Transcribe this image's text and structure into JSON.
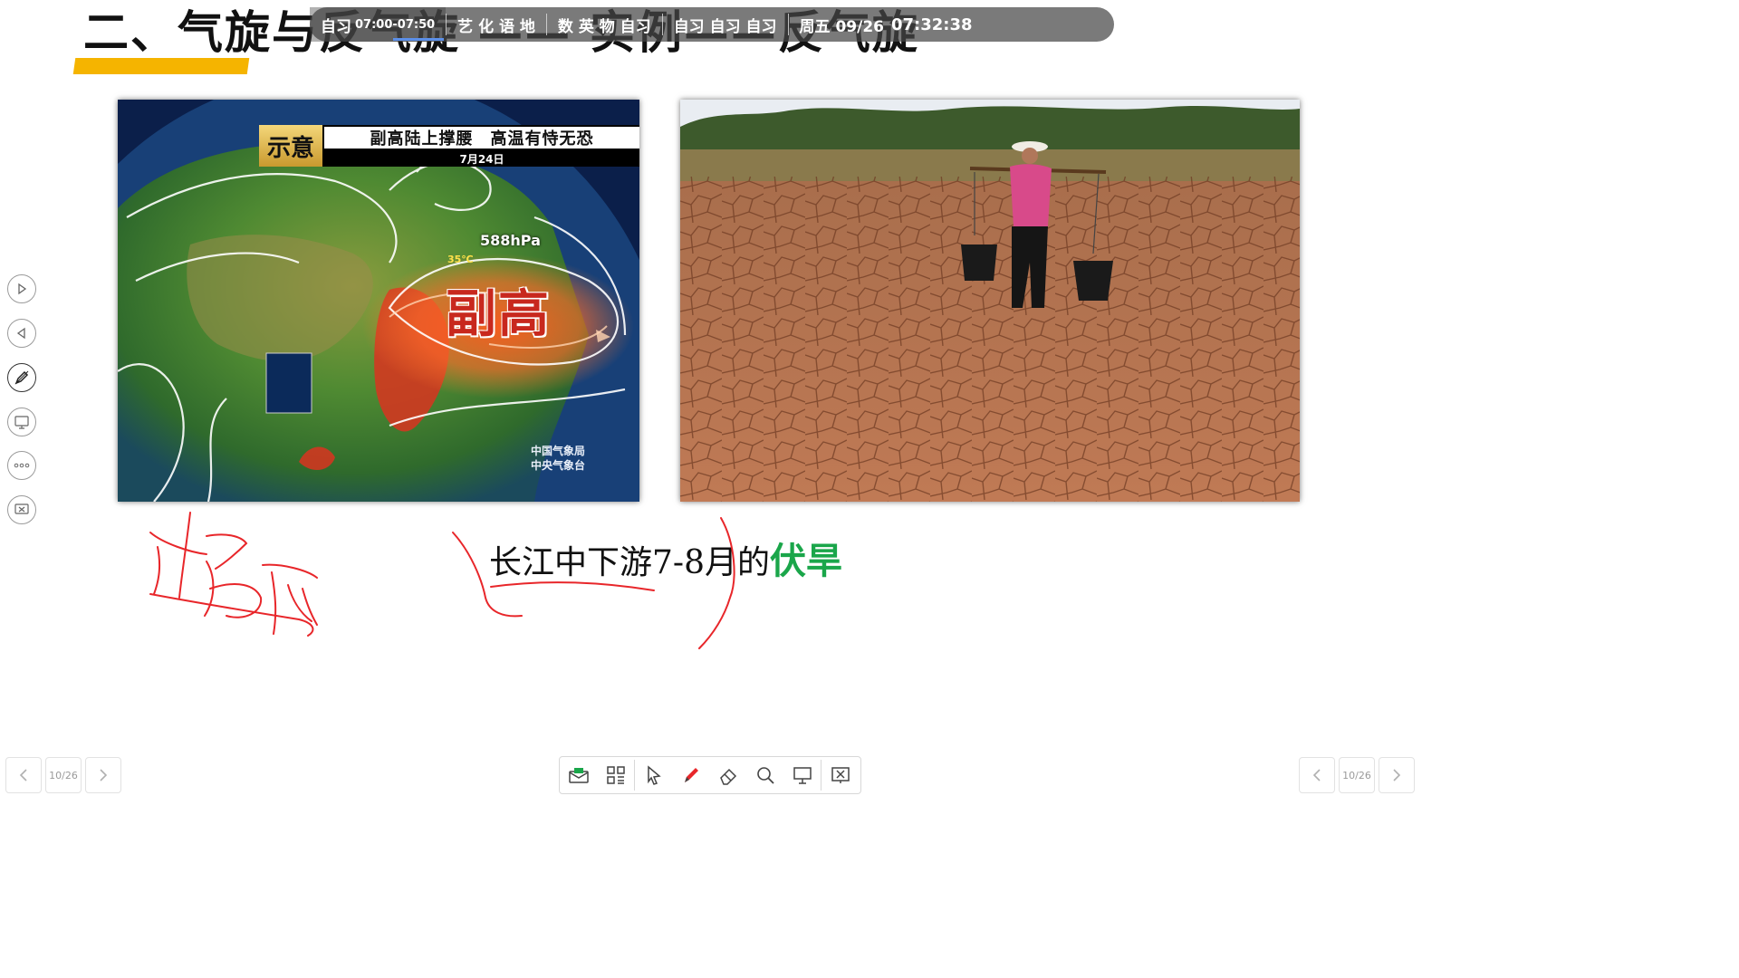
{
  "slide": {
    "title": "二、气旋与反气旋 —— 实例——反气旋",
    "caption_prefix": "长江中下游7-8月的",
    "caption_highlight": "伏旱"
  },
  "schedule_bar": {
    "current_label": "自习",
    "current_time": "07:00-07:50",
    "group1": "艺 化 语 地",
    "group2": "数 英 物 自习",
    "group3": "自习 自习 自习",
    "date": "周五 09/26",
    "clock": "07:32:38"
  },
  "weather_map": {
    "badge": "示意",
    "headline": "副高陆上撑腰　高温有恃无恐",
    "date": "7月24日",
    "pressure": "588hPa",
    "temperature": "35℃",
    "system_label": "副高",
    "agency_line1": "中国气象局",
    "agency_line2": "中央气象台"
  },
  "annotation": {
    "handwriting": "梅雨",
    "ink_color": "#e8262a"
  },
  "navigation": {
    "left_page": "10/26",
    "right_page": "10/26"
  },
  "colors": {
    "title_accent": "#f5b400",
    "highlight": "#1aa64a",
    "ink": "#e8262a"
  },
  "icons": {
    "side_toolbar": [
      "play-forward-icon",
      "play-back-icon",
      "pen-icon",
      "screen-share-icon",
      "more-icon",
      "close-presentation-icon"
    ],
    "bottom_toolbar": [
      "mail-icon",
      "qr-code-icon",
      "pointer-icon",
      "pen-icon",
      "eraser-icon",
      "search-icon",
      "board-icon",
      "presentation-close-icon"
    ]
  }
}
